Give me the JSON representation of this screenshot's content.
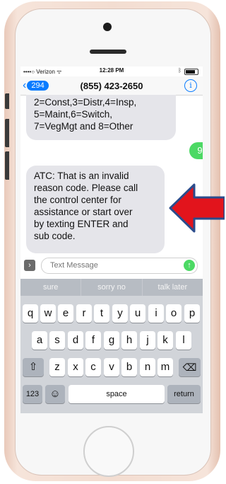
{
  "status_bar": {
    "carrier": "••••○ Verizon ᯤ",
    "time": "12:28 PM",
    "bluetooth": "ᛒ"
  },
  "nav": {
    "back_count": "294",
    "contact": "(855) 423-2650",
    "info_label": "i"
  },
  "messages": [
    {
      "direction": "incoming",
      "lines": [
        "2=Const,3=Distr,4=Insp,",
        "5=Maint,6=Switch,",
        "7=VegMgt and 8=Other"
      ]
    },
    {
      "direction": "outgoing",
      "text": "9"
    },
    {
      "direction": "incoming",
      "lines": [
        "ATC: That is an invalid",
        "reason code. Please call",
        "the control center for",
        "assistance or start over",
        "by texting ENTER and",
        "sub code."
      ]
    }
  ],
  "composer": {
    "apps_icon_label": "›",
    "placeholder": "Text Message",
    "send_icon_label": "↑"
  },
  "keyboard": {
    "suggestions": [
      "sure",
      "sorry no",
      "talk later"
    ],
    "row1": [
      "q",
      "w",
      "e",
      "r",
      "t",
      "y",
      "u",
      "i",
      "o",
      "p"
    ],
    "row2": [
      "a",
      "s",
      "d",
      "f",
      "g",
      "h",
      "j",
      "k",
      "l"
    ],
    "row3": [
      "z",
      "x",
      "c",
      "v",
      "b",
      "n",
      "m"
    ],
    "shift_label": "⇧",
    "delete_label": "⌫",
    "numbers_label": "123",
    "emoji_label": "☺",
    "space_label": "space",
    "return_label": "return"
  },
  "colors": {
    "arrow_fill": "#e2141c",
    "arrow_stroke": "#2b4c8c",
    "bubble_incoming": "#e5e5ea",
    "bubble_outgoing": "#4cd964",
    "ios_blue": "#0a7cff"
  },
  "icons": {
    "back": "chevron-left-icon",
    "info": "info-icon",
    "apps": "app-store-icon",
    "send": "send-arrow-icon",
    "annotation": "left-arrow-icon"
  }
}
